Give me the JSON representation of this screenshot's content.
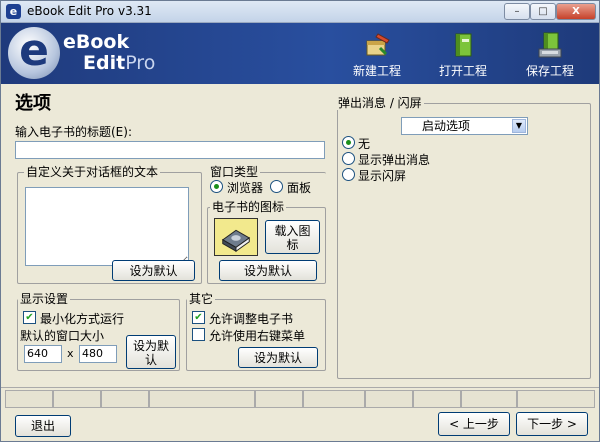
{
  "window": {
    "title": "eBook Edit Pro v3.31",
    "close": "X",
    "min": "–",
    "max": "□"
  },
  "banner": {
    "logo_letter": "e",
    "logo_line1": "eBook",
    "logo_line2_a": "Edit",
    "logo_line2_b": "Pro",
    "toolbar": {
      "new": "新建工程",
      "open": "打开工程",
      "save": "保存工程"
    }
  },
  "page": {
    "title": "选项",
    "book_title_label": "输入电子书的标题(E):",
    "book_title_value": ""
  },
  "about_group": {
    "title": "自定义关于对话框的文本",
    "default_btn": "设为默认"
  },
  "window_type": {
    "title": "窗口类型",
    "browser": "浏览器",
    "panel": "面板",
    "selected": "browser"
  },
  "icon_group": {
    "title": "电子书的图标",
    "load_line1": "载入图",
    "load_line2": "标",
    "default_btn": "设为默认"
  },
  "display": {
    "title": "显示设置",
    "minimized_label": "最小化方式运行",
    "minimized_checked": true,
    "size_label": "默认的窗口大小",
    "width": "640",
    "x_sep": "x",
    "height": "480",
    "default_line1": "设为默",
    "default_line2": "认"
  },
  "other": {
    "title": "其它",
    "resize_label": "允许调整电子书",
    "resize_checked": true,
    "rightmenu_label": "允许使用右键菜单",
    "rightmenu_checked": false,
    "default_btn": "设为默认"
  },
  "splash": {
    "title": "弹出消息 / 闪屏",
    "select_value": "启动选项",
    "options": [
      "无",
      "显示弹出消息",
      "显示闪屏"
    ],
    "selected_index": 0
  },
  "nav": {
    "exit": "退出",
    "prev": "< 上一步",
    "next": "下一步 >"
  },
  "colors": {
    "banner": "#294f9f",
    "window_bg": "#ece9d8",
    "accent": "#1d3a7d"
  }
}
